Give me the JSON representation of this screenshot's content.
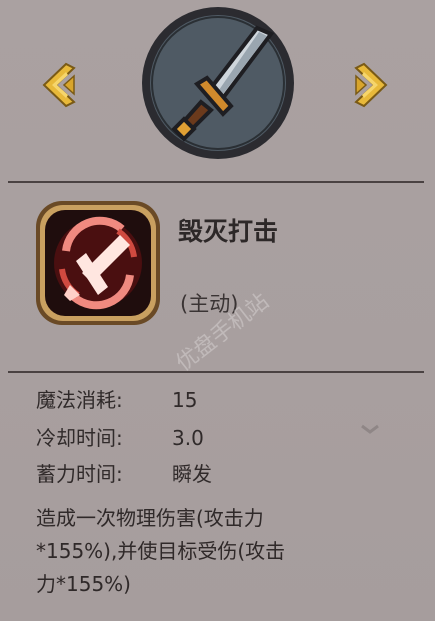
{
  "nav": {
    "prev_icon": "chevron-left-gold-icon",
    "next_icon": "chevron-right-gold-icon"
  },
  "weapon": {
    "icon": "sword-icon"
  },
  "skill": {
    "icon": "cross-slash-skill-icon",
    "name": "毁灭打击",
    "type": "(主动)"
  },
  "stats": [
    {
      "label": "魔法消耗:",
      "value": "15"
    },
    {
      "label": "冷却时间:",
      "value": "3.0"
    },
    {
      "label": "蓄力时间:",
      "value": "瞬发"
    }
  ],
  "description": {
    "lines": [
      "造成一次物理伤害(攻击力",
      "*155%),并使目标受伤(攻击",
      "力*155%)"
    ]
  },
  "watermark": "优盘手机站",
  "colors": {
    "background": "#a9a0a0",
    "gold": "#e8b93a",
    "divider": "#4a4242",
    "skill_red": "#c8332a"
  }
}
